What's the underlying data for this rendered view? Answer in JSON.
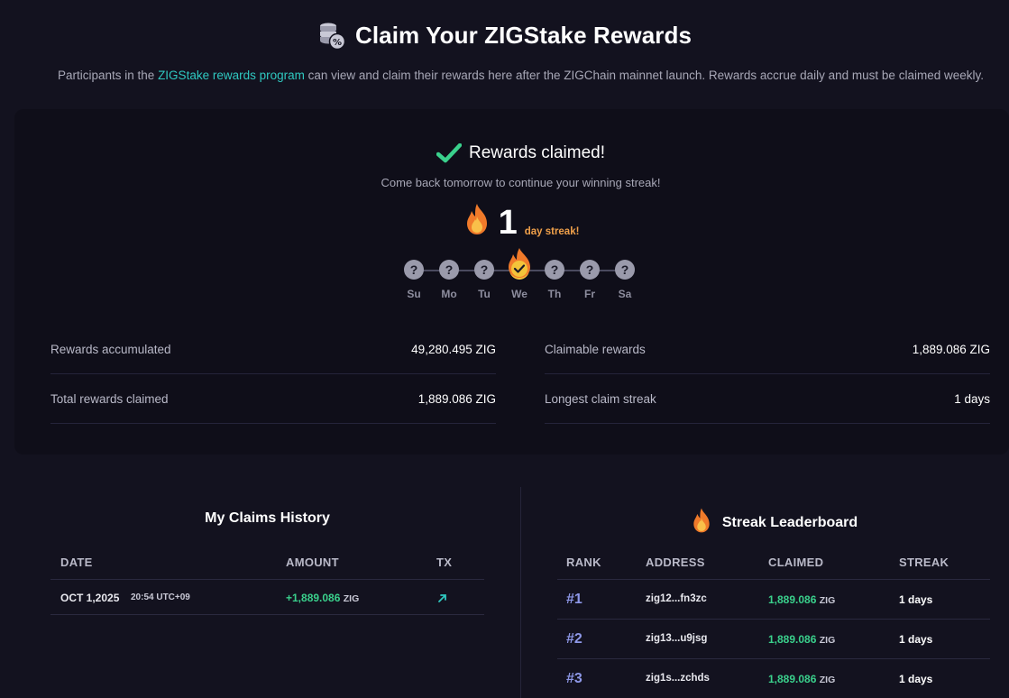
{
  "header": {
    "title": "Claim Your ZIGStake Rewards",
    "intro_before": "Participants in the ",
    "intro_link": "ZIGStake rewards program",
    "intro_after": " can view and claim their rewards here after the ZIGChain mainnet launch. Rewards accrue daily and must be claimed weekly.",
    "icon": "coins-percent-icon"
  },
  "status": {
    "title": "Rewards claimed!",
    "subtitle": "Come back tomorrow to continue your winning streak!",
    "streak_count": "1",
    "streak_label": "day streak!"
  },
  "week": {
    "days": [
      {
        "label": "Su",
        "state": "?"
      },
      {
        "label": "Mo",
        "state": "?"
      },
      {
        "label": "Tu",
        "state": "?"
      },
      {
        "label": "We",
        "state": "done"
      },
      {
        "label": "Th",
        "state": "?"
      },
      {
        "label": "Fr",
        "state": "?"
      },
      {
        "label": "Sa",
        "state": "?"
      }
    ]
  },
  "stats": {
    "rewards_accumulated": {
      "label": "Rewards accumulated",
      "value": "49,280.495 ZIG"
    },
    "total_claimed": {
      "label": "Total rewards claimed",
      "value": "1,889.086 ZIG"
    },
    "claimable": {
      "label": "Claimable rewards",
      "value": "1,889.086 ZIG"
    },
    "longest_streak": {
      "label": "Longest claim streak",
      "value": "1 days"
    }
  },
  "history": {
    "title": "My Claims History",
    "headers": {
      "date": "DATE",
      "amount": "AMOUNT",
      "tx": "TX"
    },
    "rows": [
      {
        "date": "OCT 1,2025",
        "time": "20:54 UTC+09",
        "amount": "+1,889.086",
        "unit": "ZIG",
        "tx_icon": "arrow-up-right-icon"
      }
    ]
  },
  "leaderboard": {
    "title": "Streak Leaderboard",
    "headers": {
      "rank": "RANK",
      "address": "ADDRESS",
      "claimed": "CLAIMED",
      "streak": "STREAK"
    },
    "rows": [
      {
        "rank": "#1",
        "address": "zig12...fn3zc",
        "claimed": "1,889.086",
        "unit": "ZIG",
        "streak": "1 days"
      },
      {
        "rank": "#2",
        "address": "zig13...u9jsg",
        "claimed": "1,889.086",
        "unit": "ZIG",
        "streak": "1 days"
      },
      {
        "rank": "#3",
        "address": "zig1s...zchds",
        "claimed": "1,889.086",
        "unit": "ZIG",
        "streak": "1 days"
      }
    ]
  },
  "colors": {
    "accent": "#2fc8c0",
    "green": "#3ad08c",
    "rank": "#8e98e8",
    "streak": "#f0a04a"
  }
}
